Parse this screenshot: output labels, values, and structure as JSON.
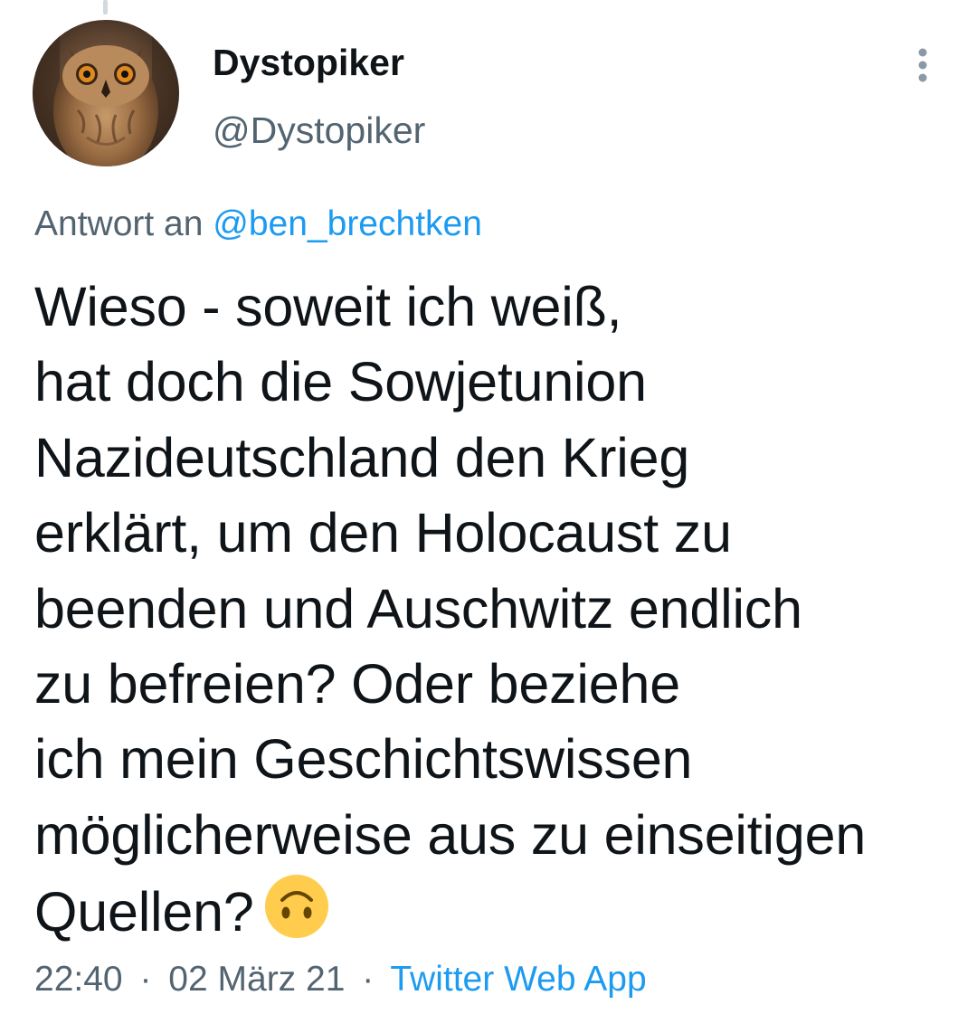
{
  "tweet": {
    "author": {
      "display_name": "Dystopiker",
      "handle": "@Dystopiker",
      "avatar_icon": "owl-avatar-icon"
    },
    "reply_to": {
      "prefix": "Antwort an",
      "mention": "@ben_brechtken"
    },
    "text_lines": [
      "Wieso - soweit ich weiß,",
      "hat doch die Sowjetunion",
      "Nazideutschland den Krieg",
      "erklärt, um den Holocaust zu",
      "beenden und Auschwitz endlich",
      "zu befreien? Oder beziehe",
      "ich mein Geschichtswissen",
      "möglicherweise aus zu einseitigen",
      "Quellen?"
    ],
    "emoji_icon": "upside-down-face-emoji-icon",
    "time": "22:40",
    "date": "02 März 21",
    "separator": "·",
    "source": "Twitter Web App"
  },
  "colors": {
    "text_primary": "#0f1419",
    "text_secondary": "#536471",
    "link": "#1d9bf0",
    "emoji_yellow": "#ffcc4d"
  }
}
